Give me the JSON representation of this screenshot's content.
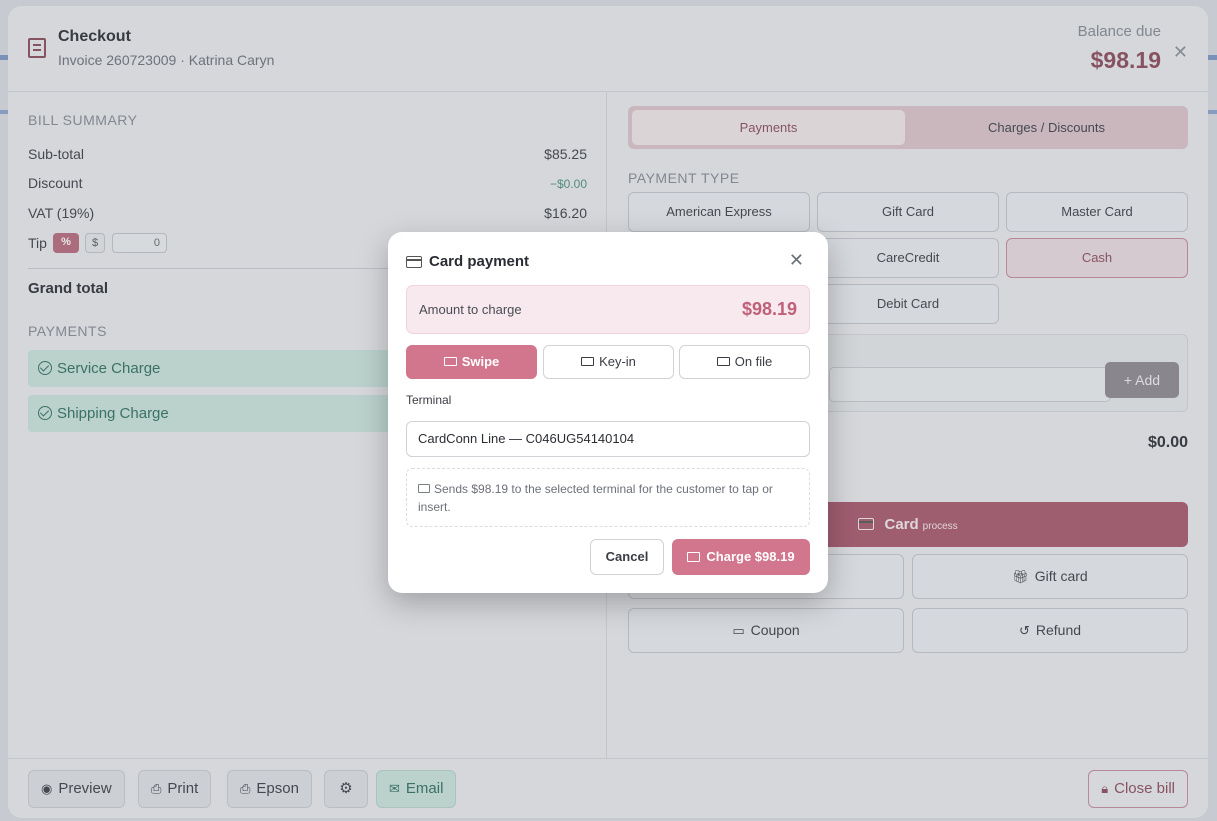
{
  "checkout": {
    "title": "Checkout",
    "subtitle": "Invoice 260723009 · Katrina Caryn",
    "balance_label": "Balance due",
    "balance_value": "$98.19",
    "close_glyph": "✕"
  },
  "bill_summary": {
    "title": "BILL SUMMARY",
    "subtotal_label": "Sub-total",
    "subtotal_value": "$85.25",
    "discount_label": "Discount",
    "discount_value": "−$0.00",
    "vat_label": "VAT (19%)",
    "vat_value": "$16.20",
    "tip_label": "Tip",
    "tip_pct": "%",
    "tip_usd": "$",
    "tip_value": "0",
    "grand_total_label": "Grand total"
  },
  "payments": {
    "title": "PAYMENTS",
    "items": [
      "Service Charge",
      "Shipping Charge"
    ]
  },
  "right": {
    "tabs": [
      "Payments",
      "Charges / Discounts"
    ],
    "payment_type_title": "PAYMENT TYPE",
    "payment_types": [
      "American Express",
      "Gift Card",
      "Master Card",
      "CareCredit",
      "Cash",
      "Debit Card"
    ],
    "selected_type": "Cash",
    "add_label": "+ Add",
    "total_value": "$0.00",
    "card_label": "Card",
    "card_sub": "process",
    "gift_card_label": "Gift card",
    "coupon_label": "Coupon",
    "refund_label": "Refund"
  },
  "footer": {
    "preview": "Preview",
    "print": "Print",
    "epson": "Epson",
    "email": "Email",
    "close_bill": "Close bill"
  },
  "modal": {
    "title": "Card payment",
    "amount_label": "Amount to charge",
    "amount_value": "$98.19",
    "modes": [
      "Swipe",
      "Key-in",
      "On file"
    ],
    "active_mode": "Swipe",
    "terminal_label": "Terminal",
    "terminal_value": "CardConn Line — C046UG54140104",
    "hint": "Sends $98.19 to the selected terminal for the customer to tap or insert.",
    "cancel": "Cancel",
    "charge": "Charge $98.19"
  },
  "colors": {
    "accent": "#d2768d",
    "accent_dark": "#a8566c",
    "success_bg": "#c8e3dc",
    "success_fg": "#2f6f5d"
  },
  "icons": [
    "receipt-icon",
    "close-icon",
    "check-circle-icon",
    "card-icon",
    "keyboard-icon",
    "id-card-icon",
    "gift-icon",
    "coupon-icon",
    "refund-icon",
    "eye-icon",
    "printer-icon",
    "gear-icon",
    "mail-icon",
    "lock-icon"
  ]
}
